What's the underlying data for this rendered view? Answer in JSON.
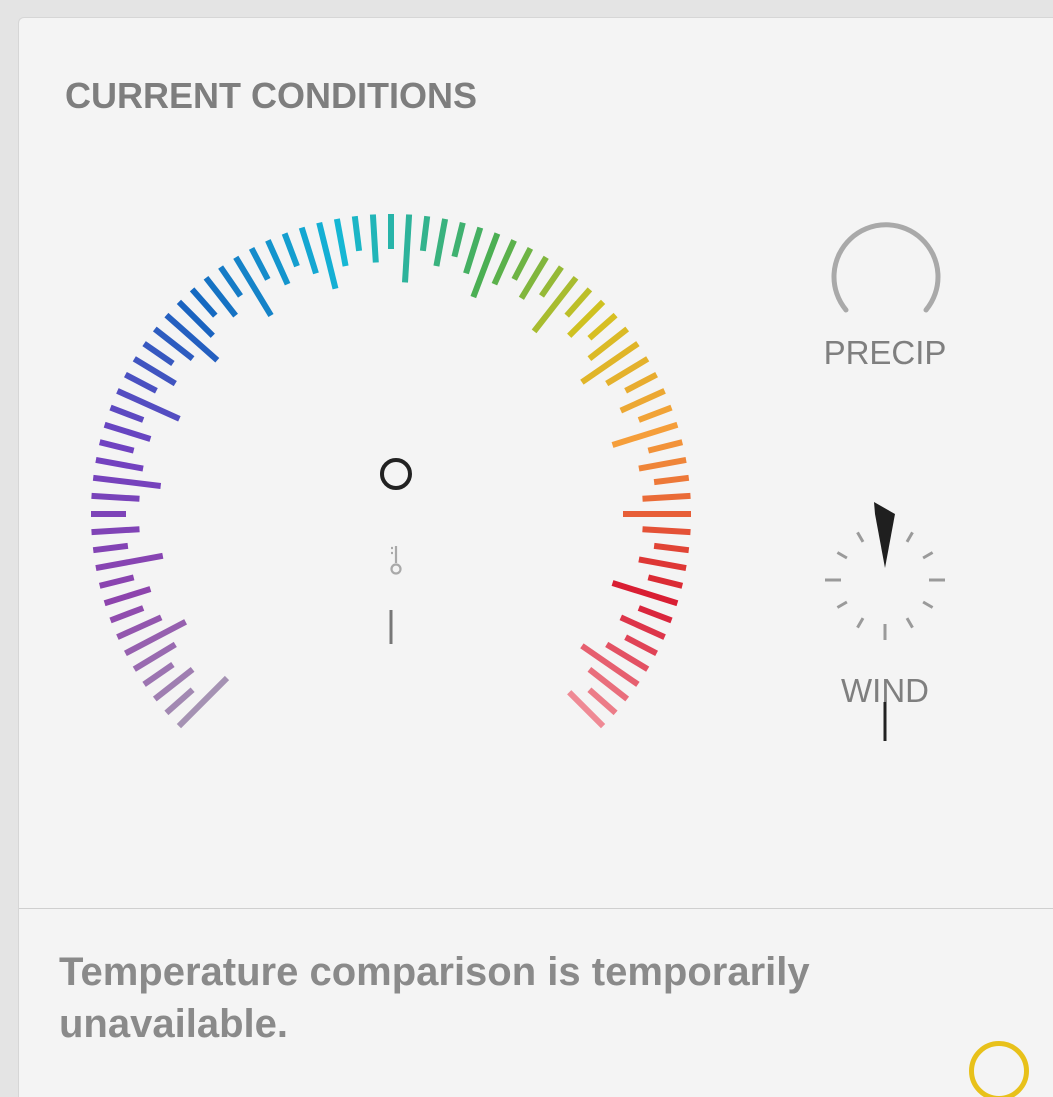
{
  "card": {
    "title": "CURRENT CONDITIONS",
    "message": "Temperature comparison is temporarily unavailable."
  },
  "temperature_gauge": {
    "value_text": "",
    "icon": "thermometer-icon",
    "tick_count": 79,
    "colors": {
      "gradient_start": "#a592b3",
      "purple": "#8e44ad",
      "violet": "#6f42c1",
      "blue": "#1565c0",
      "cyan": "#14b7d6",
      "green": "#4caf50",
      "yellow": "#d4c21f",
      "orange": "#f59e3a",
      "red": "#d81b33",
      "gradient_end": "#ef8a95"
    }
  },
  "precip": {
    "label": "PRECIP",
    "ring_color": "#a9a9a9"
  },
  "wind": {
    "label": "WIND",
    "needle_direction": "N",
    "needle_color": "#1f1f1f"
  },
  "badge": {
    "icon": "yellow-ring-icon",
    "color": "#e8c11a"
  }
}
